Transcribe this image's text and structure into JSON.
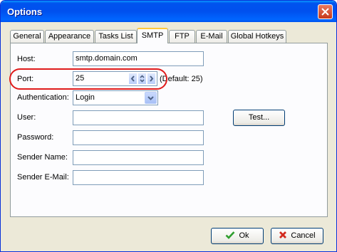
{
  "window": {
    "title": "Options"
  },
  "tabs": [
    "General",
    "Appearance",
    "Tasks List",
    "SMTP",
    "FTP",
    "E-Mail",
    "Global Hotkeys"
  ],
  "active_tab": "SMTP",
  "form": {
    "host_label": "Host:",
    "host_value": "smtp.domain.com",
    "port_label": "Port:",
    "port_value": "25",
    "port_default": "(Default: 25)",
    "auth_label": "Authentication:",
    "auth_value": "Login",
    "user_label": "User:",
    "user_value": "",
    "password_label": "Password:",
    "password_value": "",
    "sender_name_label": "Sender Name:",
    "sender_name_value": "",
    "sender_email_label": "Sender E-Mail:",
    "sender_email_value": "",
    "test_button": "Test..."
  },
  "buttons": {
    "ok": "Ok",
    "cancel": "Cancel"
  },
  "colors": {
    "highlight": "#e01b1b",
    "accent": "#0053ee"
  }
}
